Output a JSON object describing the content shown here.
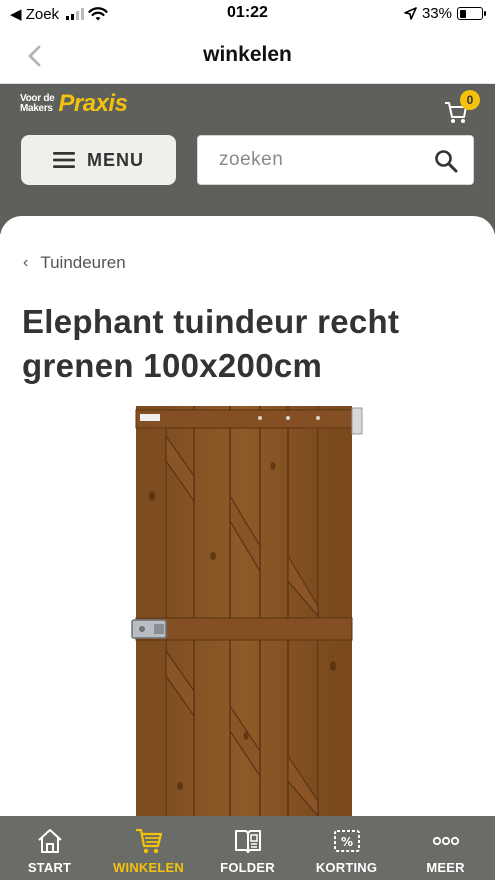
{
  "status_bar": {
    "back_label": "◀ Zoek",
    "time": "01:22",
    "battery": "33%",
    "battery_level": 0.33
  },
  "header": {
    "title": "winkelen"
  },
  "brand": {
    "tagline_line1": "Voor de",
    "tagline_line2": "Makers",
    "name": "Praxis",
    "cart_count": "0",
    "accent_color": "#f4c20d",
    "bar_color": "#5d605b"
  },
  "menu_button": {
    "label": "MENU"
  },
  "search": {
    "placeholder": "zoeken"
  },
  "breadcrumb": {
    "label": "Tuindeuren"
  },
  "product": {
    "title": "Elephant tuindeur recht grenen 100x200cm"
  },
  "tabs": [
    {
      "label": "START",
      "icon": "home-icon",
      "active": false
    },
    {
      "label": "WINKELEN",
      "icon": "cart-icon",
      "active": true
    },
    {
      "label": "FOLDER",
      "icon": "folder-book-icon",
      "active": false
    },
    {
      "label": "KORTING",
      "icon": "discount-tag-icon",
      "active": false
    },
    {
      "label": "MEER",
      "icon": "more-dots-icon",
      "active": false
    }
  ]
}
